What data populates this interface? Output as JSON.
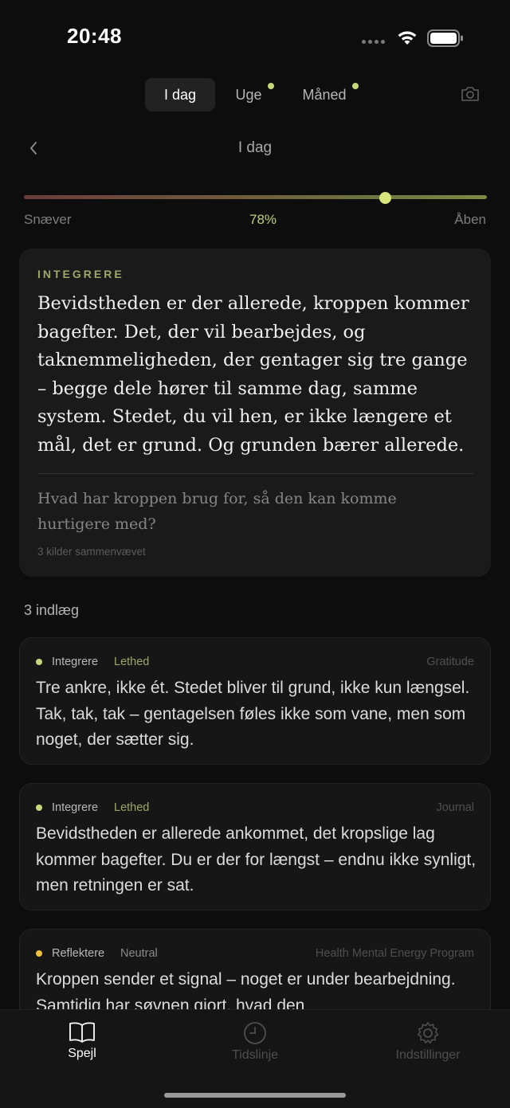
{
  "status_bar": {
    "time": "20:48"
  },
  "segments": [
    {
      "label": "I dag",
      "active": true
    },
    {
      "label": "Uge",
      "active": false
    },
    {
      "label": "Måned",
      "active": false
    }
  ],
  "icons": {
    "camera": "camera-icon",
    "back": "chevron-left-icon"
  },
  "nav": {
    "title": "I dag"
  },
  "slider": {
    "left_label": "Snæver",
    "value_label": "78%",
    "value": 0.78,
    "right_label": "Åben"
  },
  "summary": {
    "eyebrow": "INTEGRERE",
    "text": "Bevidstheden er der allerede, kroppen kommer bagefter. Det, der vil bearbejdes, og taknemmeligheden, der gentager sig tre gange – begge dele hører til samme dag, samme system. Stedet, du vil hen, er ikke længere et mål, det er grund. Og grunden bærer allerede.",
    "question": "Hvad har kroppen brug for, så den kan komme hurtigere med?",
    "sources": "3 kilder sammenvævet"
  },
  "entries_count": "3 indlæg",
  "entries": [
    {
      "category": "Integrere",
      "mood": "Lethed",
      "source": "Gratitude",
      "dot_color": "#c6d97a",
      "text": "Tre ankre, ikke ét. Stedet bliver til grund, ikke kun længsel. Tak, tak, tak – gentagelsen føles ikke som vane, men som noget, der sætter sig."
    },
    {
      "category": "Integrere",
      "mood": "Lethed",
      "source": "Journal",
      "dot_color": "#c6d97a",
      "text": "Bevidstheden er allerede ankommet, det kropslige lag kommer bagefter. Du er der for længst – endnu ikke synligt, men retningen er sat."
    },
    {
      "category": "Reflektere",
      "mood": "Neutral",
      "source": "Health Mental Energy Program",
      "dot_color": "#f0c23a",
      "text": "Kroppen sender et signal – noget er under bearbejdning. Samtidig har søvnen gjort, hvad den"
    }
  ],
  "tabbar": [
    {
      "label": "Spejl",
      "icon": "book-icon",
      "active": true
    },
    {
      "label": "Tidslinje",
      "icon": "clock-icon",
      "active": false
    },
    {
      "label": "Indstillinger",
      "icon": "gear-icon",
      "active": false
    }
  ]
}
